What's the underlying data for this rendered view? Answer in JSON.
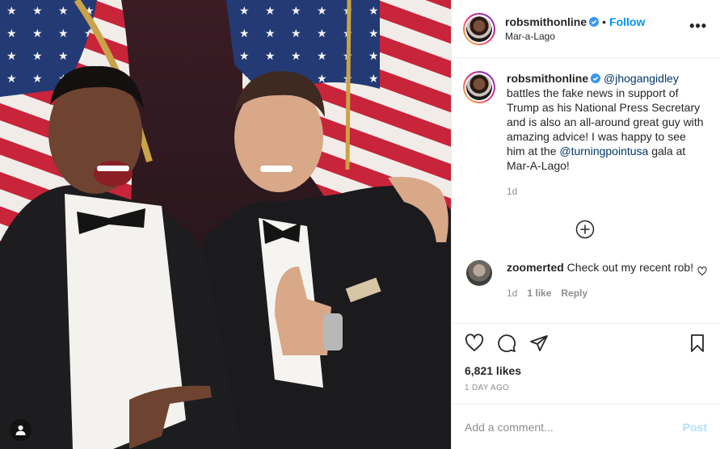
{
  "post": {
    "author": "robsmithonline",
    "follow_label": "Follow",
    "separator": "•",
    "location": "Mar-a-Lago",
    "more_label": "•••"
  },
  "caption": {
    "author": "robsmithonline",
    "mention_1": "@jhogangidley",
    "text_1": " battles the fake news in support of Trump as his National Press Secretary and is also an all-around great guy with amazing advice! I was happy to see him at the ",
    "mention_2": "@turningpointusa",
    "text_2": " gala at Mar-A-Lago!",
    "time": "1d"
  },
  "comment": {
    "author": "zoomerted",
    "text": " Check out my recent rob!",
    "time": "1d",
    "likes": "1 like",
    "reply_label": "Reply"
  },
  "stats": {
    "likes": "6,821 likes",
    "ago": "1 DAY AGO"
  },
  "add_comment": {
    "placeholder": "Add a comment...",
    "post_label": "Post"
  },
  "colors": {
    "link_blue": "#0095f6",
    "mention_blue": "#00376b",
    "muted": "#8e8e8e",
    "post_disabled": "#b2dffc"
  }
}
